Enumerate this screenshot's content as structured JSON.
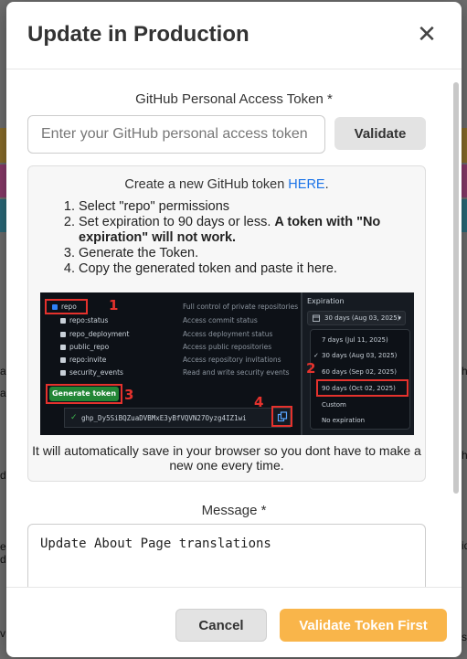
{
  "background": {
    "overlay_color": "#6e6e6e",
    "strip_colors": [
      "#8a6d2a",
      "#8a3a6a",
      "#2a6a7a"
    ],
    "left_fragments": [
      "a",
      "a",
      "d",
      "e",
      "d",
      "v"
    ],
    "right_fragments": [
      "ht",
      "ht",
      "id",
      "se"
    ]
  },
  "modal": {
    "title": "Update in Production",
    "close_icon": "close-icon",
    "token_field": {
      "label": "GitHub Personal Access Token *",
      "placeholder": "Enter your GitHub personal access token",
      "value": ""
    },
    "validate_button": "Validate",
    "info": {
      "create_prefix": "Create a new GitHub token ",
      "create_link": "HERE",
      "create_suffix": ".",
      "steps": [
        {
          "text": "Select \"repo\" permissions",
          "bold": ""
        },
        {
          "text": "Set expiration to 90 days or less. ",
          "bold": "A token with \"No expiration\" will not work."
        },
        {
          "text": "Generate the Token.",
          "bold": ""
        },
        {
          "text": "Copy the generated token and paste it here.",
          "bold": ""
        }
      ],
      "screenshot": {
        "permissions": [
          {
            "name": "repo",
            "desc": "Full control of private repositories",
            "checked": true
          },
          {
            "name": "repo:status",
            "desc": "Access commit status",
            "checked": false
          },
          {
            "name": "repo_deployment",
            "desc": "Access deployment status",
            "checked": false
          },
          {
            "name": "public_repo",
            "desc": "Access public repositories",
            "checked": false
          },
          {
            "name": "repo:invite",
            "desc": "Access repository invitations",
            "checked": false
          },
          {
            "name": "security_events",
            "desc": "Read and write security events",
            "checked": false
          }
        ],
        "generate_button": "Generate token",
        "token_value": "ghp_Dy5SiBQZuaDVBMxE3yBfVQVN27Oyzg4IZ1wi",
        "expiration_label": "Expiration",
        "expiration_selected": "30 days (Aug 03, 2025)",
        "expiration_options": [
          {
            "label": "7 days (Jul 11, 2025)",
            "checked": false
          },
          {
            "label": "30 days (Aug 03, 2025)",
            "checked": true
          },
          {
            "label": "60 days (Sep 02, 2025)",
            "checked": false
          },
          {
            "label": "90 days (Oct 02, 2025)",
            "checked": false
          },
          {
            "label": "Custom",
            "checked": false
          },
          {
            "label": "No expiration",
            "checked": false
          }
        ],
        "markers": [
          "1",
          "2",
          "3",
          "4"
        ],
        "marker_color": "#e5322d"
      },
      "save_note": "It will automatically save in your browser so you dont have to make a new one every time."
    },
    "message_field": {
      "label": "Message *",
      "value": "Update About Page translations"
    },
    "cancel_button": "Cancel",
    "primary_button": "Validate Token First",
    "accent_color": "#f9b54a",
    "link_color": "#1a73e8"
  }
}
